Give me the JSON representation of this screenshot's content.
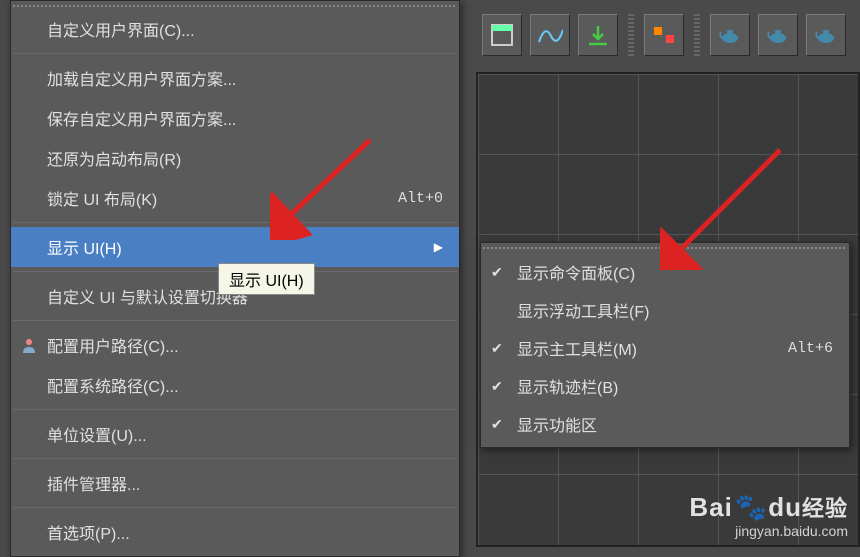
{
  "menu": {
    "items": [
      {
        "label": "自定义用户界面(C)...",
        "icon": null
      },
      {
        "label": "加载自定义用户界面方案...",
        "icon": null
      },
      {
        "label": "保存自定义用户界面方案...",
        "icon": null
      },
      {
        "label": "还原为启动布局(R)",
        "icon": null
      },
      {
        "label": "锁定 UI 布局(K)",
        "shortcut": "Alt+0"
      },
      {
        "label": "显示 UI(H)",
        "submenu": true,
        "highlighted": true
      },
      {
        "label": "自定义 UI 与默认设置切换器"
      },
      {
        "label": "配置用户路径(C)...",
        "icon": "user"
      },
      {
        "label": "配置系统路径(C)..."
      },
      {
        "label": "单位设置(U)..."
      },
      {
        "label": "插件管理器..."
      },
      {
        "label": "首选项(P)..."
      }
    ],
    "tooltip": "显示 UI(H)"
  },
  "submenu": {
    "items": [
      {
        "label": "显示命令面板(C)",
        "checked": true
      },
      {
        "label": "显示浮动工具栏(F)",
        "checked": false
      },
      {
        "label": "显示主工具栏(M)",
        "checked": true,
        "shortcut": "Alt+6"
      },
      {
        "label": "显示轨迹栏(B)",
        "checked": true
      },
      {
        "label": "显示功能区",
        "checked": true
      }
    ]
  },
  "toolbar": {
    "buttons": [
      "window-icon",
      "curve-icon",
      "download-icon",
      "align-icon",
      "teapot-1-icon",
      "teapot-2-icon",
      "teapot-3-icon"
    ]
  },
  "watermark": {
    "brand_en": "Bai",
    "brand_mid": "du",
    "brand_cn": "经验",
    "url": "jingyan.baidu.com"
  }
}
